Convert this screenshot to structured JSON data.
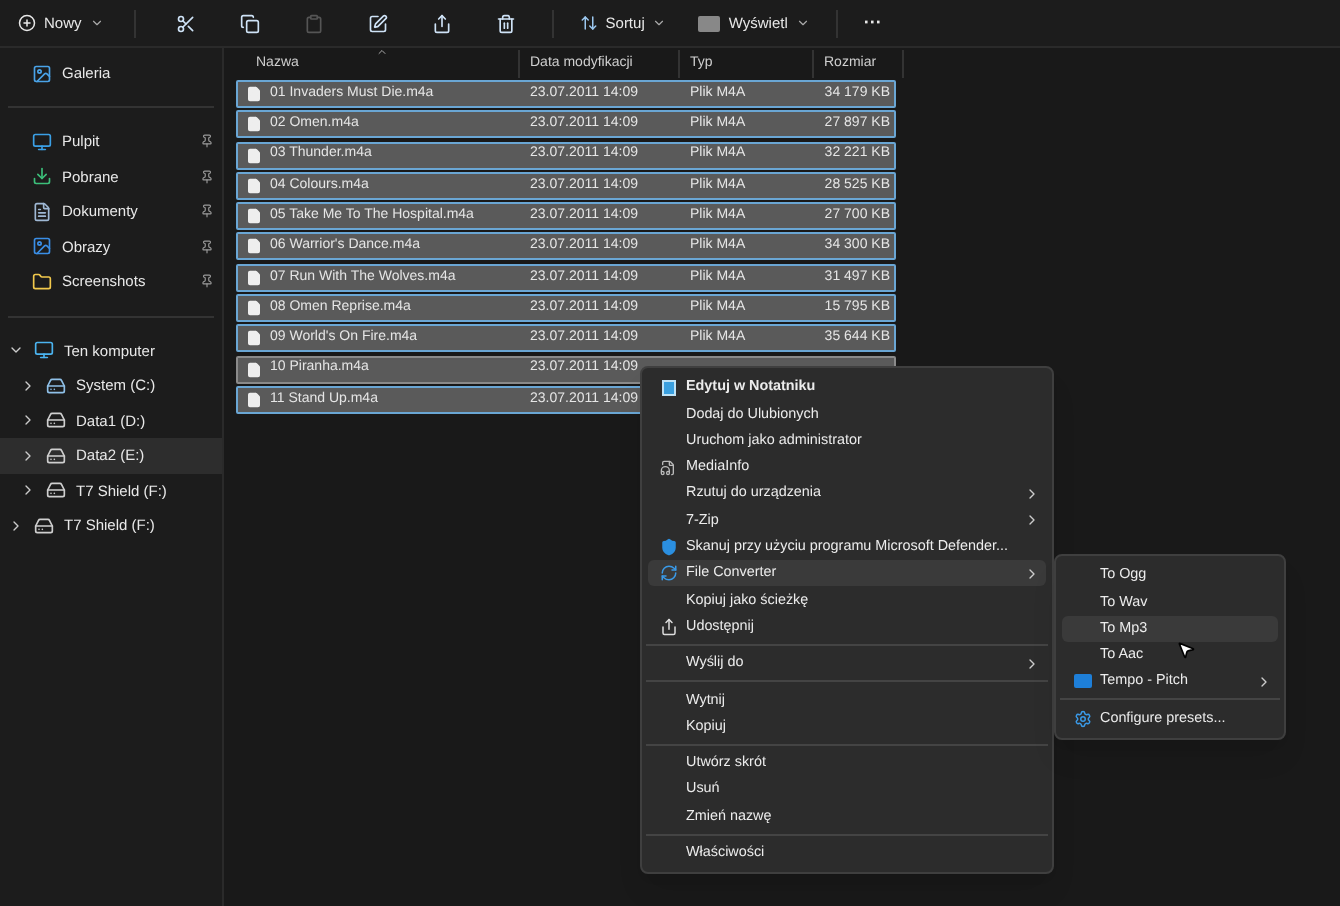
{
  "toolbar": {
    "new_button": "Nowy",
    "actions": [
      {
        "kind": "cut",
        "disabled": false
      },
      {
        "kind": "copy",
        "disabled": false
      },
      {
        "kind": "paste",
        "disabled": true
      },
      {
        "kind": "rename",
        "disabled": false
      },
      {
        "kind": "share",
        "disabled": false
      },
      {
        "kind": "delete",
        "disabled": false
      }
    ],
    "sort_button": "Sortuj",
    "view_button": "Wyświetl",
    "more_button": "···"
  },
  "sidebar": {
    "top": [
      {
        "label": "Galeria",
        "kind": "gallery"
      }
    ],
    "pinned": [
      {
        "label": "Pulpit",
        "kind": "desktop"
      },
      {
        "label": "Pobrane",
        "kind": "download"
      },
      {
        "label": "Dokumenty",
        "kind": "documents"
      },
      {
        "label": "Obrazy",
        "kind": "pictures"
      },
      {
        "label": "Screenshots",
        "kind": "folder"
      }
    ],
    "tree": [
      {
        "label": "Ten komputer",
        "kind": "computer",
        "expanded": true,
        "selected": false,
        "children": [
          {
            "label": "System (C:)",
            "kind": "system",
            "expanded": false,
            "selected": false
          },
          {
            "label": "Data1 (D:)",
            "kind": "drive",
            "expanded": false,
            "selected": false
          },
          {
            "label": "Data2 (E:)",
            "kind": "drive",
            "expanded": false,
            "selected": true
          },
          {
            "label": "T7 Shield (F:)",
            "kind": "drive",
            "expanded": false,
            "selected": false
          }
        ]
      },
      {
        "label": "T7 Shield (F:)",
        "kind": "drive",
        "expanded": false,
        "selected": false
      }
    ]
  },
  "table": {
    "columns": [
      "Nazwa",
      "Data modyfikacji",
      "Typ",
      "Rozmiar"
    ],
    "rows": [
      {
        "name": "01 Invaders Must Die.m4a",
        "date": "23.07.2011 14:09",
        "type": "Plik M4A",
        "size": "34 179 KB",
        "selected": true
      },
      {
        "name": "02 Omen.m4a",
        "date": "23.07.2011 14:09",
        "type": "Plik M4A",
        "size": "27 897 KB",
        "selected": true
      },
      {
        "name": "03 Thunder.m4a",
        "date": "23.07.2011 14:09",
        "type": "Plik M4A",
        "size": "32 221 KB",
        "selected": true
      },
      {
        "name": "04 Colours.m4a",
        "date": "23.07.2011 14:09",
        "type": "Plik M4A",
        "size": "28 525 KB",
        "selected": true
      },
      {
        "name": "05 Take Me To The Hospital.m4a",
        "date": "23.07.2011 14:09",
        "type": "Plik M4A",
        "size": "27 700 KB",
        "selected": true
      },
      {
        "name": "06 Warrior's Dance.m4a",
        "date": "23.07.2011 14:09",
        "type": "Plik M4A",
        "size": "34 300 KB",
        "selected": true
      },
      {
        "name": "07 Run With The Wolves.m4a",
        "date": "23.07.2011 14:09",
        "type": "Plik M4A",
        "size": "31 497 KB",
        "selected": true
      },
      {
        "name": "08 Omen Reprise.m4a",
        "date": "23.07.2011 14:09",
        "type": "Plik M4A",
        "size": "15 795 KB",
        "selected": true
      },
      {
        "name": "09 World's On Fire.m4a",
        "date": "23.07.2011 14:09",
        "type": "Plik M4A",
        "size": "35 644 KB",
        "selected": true
      },
      {
        "name": "10 Piranha.m4a",
        "date": "23.07.2011 14:09",
        "selected": false
      },
      {
        "name": "11 Stand Up.m4a",
        "date": "23.07.2011 14:09",
        "selected": true
      }
    ]
  },
  "context_menu": {
    "items": [
      {
        "kind": "notepad",
        "label": "Edytuj w Notatniku",
        "default": true,
        "submenu": false,
        "selected": false
      },
      {
        "kind": "plain",
        "label": "Dodaj do Ulubionych",
        "default": false,
        "submenu": false,
        "selected": false
      },
      {
        "kind": "plain",
        "label": "Uruchom jako administrator",
        "default": false,
        "submenu": false,
        "selected": false
      },
      {
        "kind": "mediainfo",
        "label": "MediaInfo",
        "default": false,
        "submenu": false,
        "selected": false
      },
      {
        "kind": "plain",
        "label": "Rzutuj do urządzenia",
        "default": false,
        "submenu": true,
        "selected": false
      },
      {
        "kind": "plain",
        "label": "7-Zip",
        "default": false,
        "submenu": true,
        "selected": false
      },
      {
        "kind": "shield",
        "label": "Skanuj przy użyciu programu Microsoft Defender...",
        "default": false,
        "submenu": false,
        "selected": false
      },
      {
        "kind": "converter",
        "label": "File Converter",
        "default": false,
        "submenu": true,
        "selected": true
      },
      {
        "kind": "plain",
        "label": "Kopiuj jako ścieżkę",
        "default": false,
        "submenu": false,
        "selected": false
      },
      {
        "kind": "share",
        "label": "Udostępnij",
        "default": false,
        "submenu": false,
        "selected": false
      },
      {
        "kind": "separator"
      },
      {
        "kind": "plain",
        "label": "Wyślij do",
        "default": false,
        "submenu": true,
        "selected": false
      },
      {
        "kind": "separator"
      },
      {
        "kind": "plain",
        "label": "Wytnij",
        "default": false,
        "submenu": false,
        "selected": false
      },
      {
        "kind": "plain",
        "label": "Kopiuj",
        "default": false,
        "submenu": false,
        "selected": false
      },
      {
        "kind": "separator"
      },
      {
        "kind": "plain",
        "label": "Utwórz skrót",
        "default": false,
        "submenu": false,
        "selected": false
      },
      {
        "kind": "plain",
        "label": "Usuń",
        "default": false,
        "submenu": false,
        "selected": false
      },
      {
        "kind": "plain",
        "label": "Zmień nazwę",
        "default": false,
        "submenu": false,
        "selected": false
      },
      {
        "kind": "separator"
      },
      {
        "kind": "plain",
        "label": "Właściwości",
        "default": false,
        "submenu": false,
        "selected": false
      }
    ]
  },
  "submenu": {
    "items": [
      {
        "kind": "plain",
        "label": "To Ogg",
        "submenu": false,
        "selected": false
      },
      {
        "kind": "plain",
        "label": "To Wav",
        "submenu": false,
        "selected": false
      },
      {
        "kind": "plain",
        "label": "To Mp3",
        "submenu": false,
        "selected": true
      },
      {
        "kind": "plain",
        "label": "To Aac",
        "submenu": false,
        "selected": false
      },
      {
        "kind": "folder",
        "label": "Tempo - Pitch",
        "submenu": true,
        "selected": false
      },
      {
        "kind": "separator"
      },
      {
        "kind": "gear",
        "label": "Configure presets...",
        "submenu": false,
        "selected": false
      }
    ]
  }
}
